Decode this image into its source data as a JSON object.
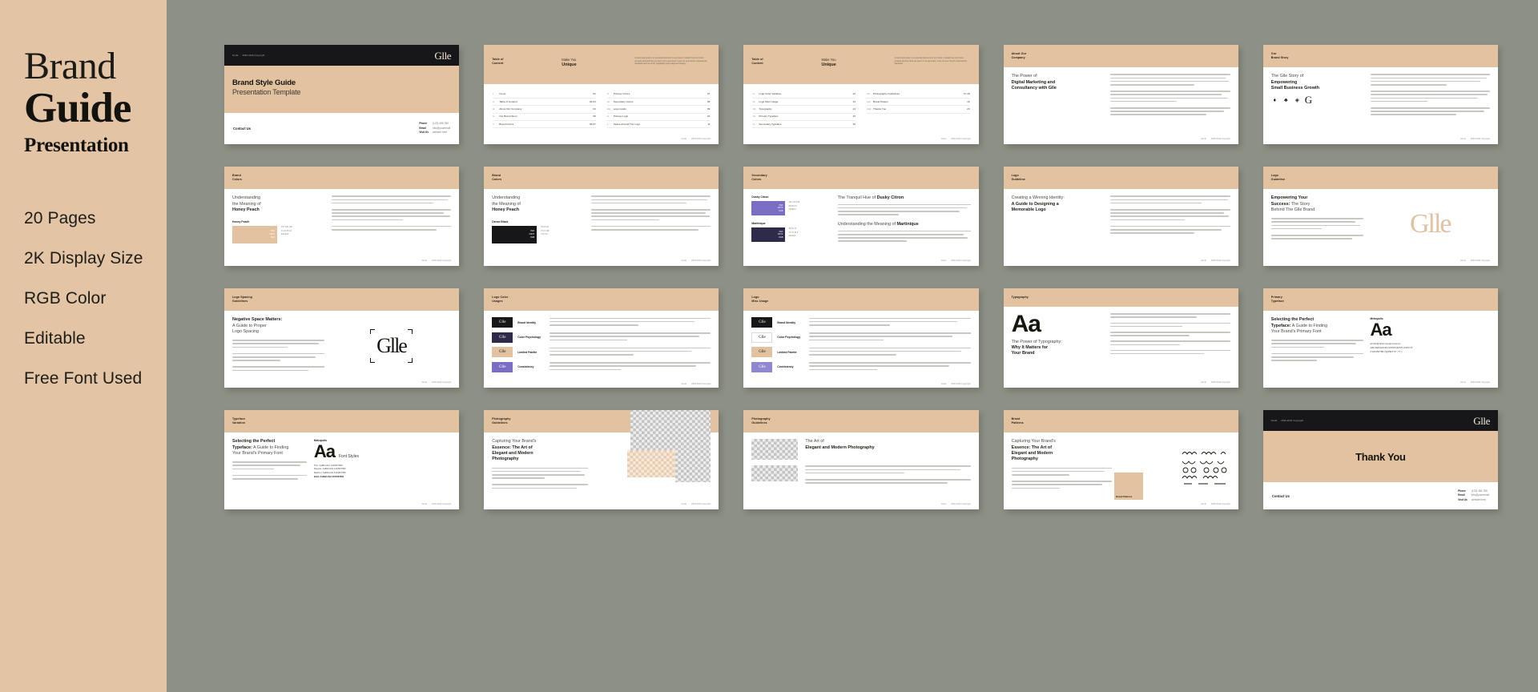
{
  "sidebar": {
    "title_line1": "Brand",
    "title_line2": "Guide",
    "title_line3": "Presentation",
    "features": [
      "20 Pages",
      "2K Display Size",
      "RGB Color",
      "Editable",
      "Free Font Used"
    ]
  },
  "colors": {
    "panel_bg": "#e3c4a5",
    "canvas_bg": "#8d9084",
    "slide_bg": "#ffffff",
    "accent_peach": "#e3c2a0",
    "dark_bar": "#17171a",
    "dusky_citron": "#7a6ec4",
    "martinique": "#2e2a4a",
    "honey_peach": "#e3c2a0"
  },
  "common": {
    "brand_mark": "Glle",
    "header_micro_left": "GLLE",
    "header_micro_right": "2030-2040 Copyright",
    "footer_micro_left": "GLLE",
    "footer_micro_right": "2030-2040 Copyright"
  },
  "contact": {
    "heading": "Contact Us",
    "rows": [
      {
        "key": "Phone",
        "value": "(123) 456 789"
      },
      {
        "key": "Email",
        "value": "info@youremail"
      },
      {
        "key": "Visit Us",
        "value": "website here"
      }
    ]
  },
  "slides": [
    {
      "n": 1,
      "kind": "cover",
      "title": "Brand Style Guide",
      "subtitle": "Presentation Template"
    },
    {
      "n": 2,
      "kind": "toc",
      "header_left": "Table of\nContent",
      "header_left_l1": "Table of",
      "header_left_l2": "Content",
      "header_right_l1": "Make You",
      "header_right_l2": "Unique",
      "intro": "A brand style guide is an essential document for any brand. It details how your brand presents itself and how you want it to be perceived. It sets out your brand's visual identity standards such as colors, typography, logo usage and imagery.",
      "col_left": [
        {
          "n": "i.",
          "label": "Cover",
          "page": "01"
        },
        {
          "n": "ii.",
          "label": "Table of Content",
          "page": "02-03"
        },
        {
          "n": "iii.",
          "label": "About Our Company",
          "page": "04"
        },
        {
          "n": "iv.",
          "label": "Our Brand Story",
          "page": "05"
        },
        {
          "n": "v.",
          "label": "Brand Colors",
          "page": "06-07"
        }
      ],
      "col_right": [
        {
          "n": "vi.",
          "label": "Primary Colors",
          "page": "07"
        },
        {
          "n": "vii.",
          "label": "Secondary Colors",
          "page": "08"
        },
        {
          "n": "viii.",
          "label": "Logo Guide",
          "page": "09"
        },
        {
          "n": "ix.",
          "label": "Primary Logo",
          "page": "10"
        },
        {
          "n": "x.",
          "label": "Space Around The Logo",
          "page": "11"
        }
      ]
    },
    {
      "n": 3,
      "kind": "toc",
      "header_left_l1": "Table of",
      "header_left_l2": "Content",
      "header_right_l1": "Make You",
      "header_right_l2": "Unique",
      "intro": "A brand style guide is an essential document for any brand. It details how your brand presents itself and how you want it to be perceived. It sets out your brand's visual identity standards.",
      "col_left": [
        {
          "n": "xi.",
          "label": "Logo Color Variation",
          "page": "12"
        },
        {
          "n": "xii.",
          "label": "Logo Misc Usage",
          "page": "13"
        },
        {
          "n": "xiii.",
          "label": "Typography",
          "page": "14"
        },
        {
          "n": "xiv.",
          "label": "Primary Typeface",
          "page": "15"
        },
        {
          "n": "xv.",
          "label": "Secondary Typeface",
          "page": "16"
        }
      ],
      "col_right": [
        {
          "n": "xvi.",
          "label": "Photography Guidelines",
          "page": "17-18"
        },
        {
          "n": "xvii.",
          "label": "Brand Pattern",
          "page": "19"
        },
        {
          "n": "xviii.",
          "label": "Thanks You",
          "page": "20"
        }
      ]
    },
    {
      "n": 4,
      "kind": "text-split",
      "eyebrow_l1": "About Our",
      "eyebrow_l2": "Company",
      "head_thin": "The Power of",
      "head_bold_l1": "Digital Marketing and",
      "head_bold_l2": "Consultancy",
      "head_bold_tail": "with Glle"
    },
    {
      "n": 5,
      "kind": "brand-story",
      "eyebrow_l1": "Our",
      "eyebrow_l2": "Brand Story",
      "head_l1": "The Glle Story of",
      "head_bold_l1": "Empowering",
      "head_bold_l2": "Small Business Growth"
    },
    {
      "n": 6,
      "kind": "swatch",
      "eyebrow_l1": "Brand",
      "eyebrow_l2": "Colors",
      "head_thin": "Understanding",
      "head_l2": "the Meaning of",
      "head_bold": "Honey Peach",
      "swatch_name": "Honey Peach",
      "swatch_hex": "#E3C2A0",
      "swatch_labels": [
        "HEX",
        "CMYK",
        "RGB"
      ],
      "swatch_codes": [
        "227 194 160",
        "11 24 36 01",
        "E3C2A0"
      ]
    },
    {
      "n": 7,
      "kind": "swatch",
      "eyebrow_l1": "Brand",
      "eyebrow_l2": "Colors",
      "head_thin": "Understanding",
      "head_l2": "the Meaning of",
      "head_bold": "Honey Peach",
      "swatch_name": "Dense Black",
      "swatch_hex": "#17171A",
      "swatch_labels": [
        "HEX",
        "CMYK",
        "RGB"
      ],
      "swatch_codes": [
        "23 23 26",
        "0 0 0 100",
        "17171A"
      ]
    },
    {
      "n": 8,
      "kind": "secondary",
      "eyebrow_l1": "Secondary",
      "eyebrow_l2": "Colors",
      "head_a_thin": "The Tranquil Hue of",
      "head_a_bold": "Dusky Citron",
      "head_b_thin": "Understanding the Meaning of",
      "head_b_bold": "Martinique",
      "sw1_name": "Dusky Citron",
      "sw1_hex": "#7A6EC4",
      "sw1_codes": [
        "122 110 196",
        "68 56 0 0",
        "7A6EC4"
      ],
      "sw2_name": "Martinique",
      "sw2_hex": "#2E2A4A",
      "sw2_codes": [
        "46 42 74",
        "76 72 32 0",
        "2E2A4A"
      ]
    },
    {
      "n": 9,
      "kind": "text-split",
      "eyebrow_l1": "Logo",
      "eyebrow_l2": "Guideline",
      "head_thin": "Creating a Winning Identity:",
      "head_bold_l1": "A Guide to",
      "head_bold_l2": "Designing a",
      "head_bold_l3": "Memorable Logo"
    },
    {
      "n": 10,
      "kind": "watermark",
      "eyebrow_l1": "Logo",
      "eyebrow_l2": "Guideline",
      "head_bold_l1": "Empowering Your",
      "head_bold_l2": "Success:",
      "head_thin_l2": "The Story",
      "head_l3": "Behind The Glle Brand",
      "mark": "Glle"
    },
    {
      "n": 11,
      "kind": "spacing",
      "eyebrow_l1": "Logo Spacing",
      "eyebrow_l2": "Guidelines",
      "head_bold": "Negative Space Matters:",
      "head_l2": "A Guide to Proper",
      "head_l3": "Logo Spacing",
      "mark": "Glle"
    },
    {
      "n": 12,
      "kind": "usage",
      "eyebrow_l1": "Logo Color",
      "eyebrow_l2": "Usages",
      "rows": [
        {
          "label": "Brand Identity",
          "chip": "#17171a",
          "chip_text": "#f3ead9"
        },
        {
          "label": "Color Psychology",
          "chip": "#2e2a4a",
          "chip_text": "#f3ead9"
        },
        {
          "label": "Limited Palette",
          "chip": "#e3c2a0",
          "chip_text": "#17171a"
        },
        {
          "label": "Consistency",
          "chip": "#7a6ec4",
          "chip_text": "#ffffff"
        }
      ]
    },
    {
      "n": 13,
      "kind": "usage",
      "eyebrow_l1": "Logo",
      "eyebrow_l2": "Misc Usage",
      "rows": [
        {
          "label": "Brand Identity",
          "chip": "#17171a",
          "chip_text": "#f3ead9"
        },
        {
          "label": "Color Psychology",
          "chip": "#ffffff",
          "chip_text": "#17171a"
        },
        {
          "label": "Limited Palette",
          "chip": "#e3c2a0",
          "chip_text": "#17171a"
        },
        {
          "label": "Consistency",
          "chip": "#8f87cf",
          "chip_text": "#ffffff"
        }
      ]
    },
    {
      "n": 14,
      "kind": "typography",
      "eyebrow": "Typography",
      "aa": "Aa",
      "head_thin": "The Power of Typography:",
      "head_bold_l1": "Why It Matters for",
      "head_bold_l2": "Your Brand"
    },
    {
      "n": 15,
      "kind": "primary-type",
      "eyebrow_l1": "Primary",
      "eyebrow_l2": "Typeface",
      "head_bold": "Selecting the Perfect",
      "head_l2": "Typeface:",
      "head_thin_l2": "A Guide to Finding",
      "head_l3": "Your Brand's Primary Font",
      "font_name": "Metropolis",
      "aa": "Aa",
      "glyph_lower": "abcdefghijklmnopqrstuvwxyz",
      "glyph_upper": "ABCDEFGHIJKLMNOPQRSTUVWXYZ",
      "glyph_num": "0123456789 (!@#$%^&*.,?/:;)"
    },
    {
      "n": 16,
      "kind": "type-variation",
      "eyebrow_l1": "Typeface",
      "eyebrow_l2": "Variation",
      "head_bold": "Selecting the Perfect",
      "head_l2": "Typeface:",
      "head_thin_l2": "A Guide to Finding",
      "head_l3": "Your Brand's Primary Font",
      "font_name": "Metropolis",
      "aa": "Aa",
      "aa_caption": "Font Styles",
      "styles": [
        "Thin: AaBbCcDd 1234567890",
        "Regular: AaBbCcDd 1234567890",
        "Medium: AaBbCcDd 1234567890",
        "Bold: AaBbCcDd 1234567890"
      ]
    },
    {
      "n": 17,
      "kind": "photo-a",
      "eyebrow_l1": "Photography",
      "eyebrow_l2": "Guidelines",
      "head_thin": "Capturing Your Brand's",
      "head_bold_l1": "Essence: The Art of",
      "head_bold_l2": "Elegant and Modern",
      "head_bold_l3": "Photography"
    },
    {
      "n": 18,
      "kind": "photo-b",
      "eyebrow_l1": "Photography",
      "eyebrow_l2": "Guidelines",
      "head_thin": "The Art of",
      "head_bold": "Elegant and Modern Photography"
    },
    {
      "n": 19,
      "kind": "pattern",
      "eyebrow_l1": "Brand",
      "eyebrow_l2": "Patterns",
      "head_thin": "Capturing Your Brand's",
      "head_bold_l1": "Essence: The Art of",
      "head_bold_l2": "Elegant and Modern",
      "head_bold_l3": "Photography",
      "pattern_label": "Brand Patterns"
    },
    {
      "n": 20,
      "kind": "thanks",
      "title": "Thank You"
    }
  ]
}
